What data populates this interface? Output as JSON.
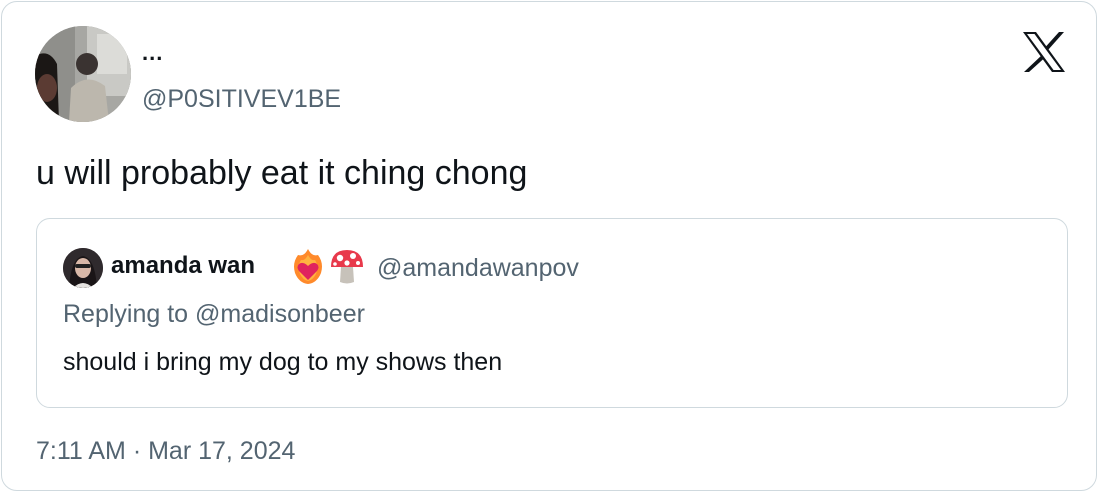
{
  "tweet": {
    "author": {
      "display_name": "...",
      "handle": "@P0SITIVEV1BE"
    },
    "text": "u will probably eat it ching chong",
    "timestamp": "7:11 AM · Mar 17, 2024",
    "brand_icon": "x-logo-icon"
  },
  "quoted_tweet": {
    "author": {
      "display_name": "amanda wan",
      "emojis": [
        "heart-on-fire-icon",
        "mushroom-icon"
      ],
      "handle": "@amandawanpov"
    },
    "reply_context": "Replying to @madisonbeer",
    "text": "should i bring my dog to my shows then"
  },
  "colors": {
    "text_primary": "#0f1419",
    "text_secondary": "#536471",
    "border": "#cfd9de",
    "background": "#ffffff"
  }
}
